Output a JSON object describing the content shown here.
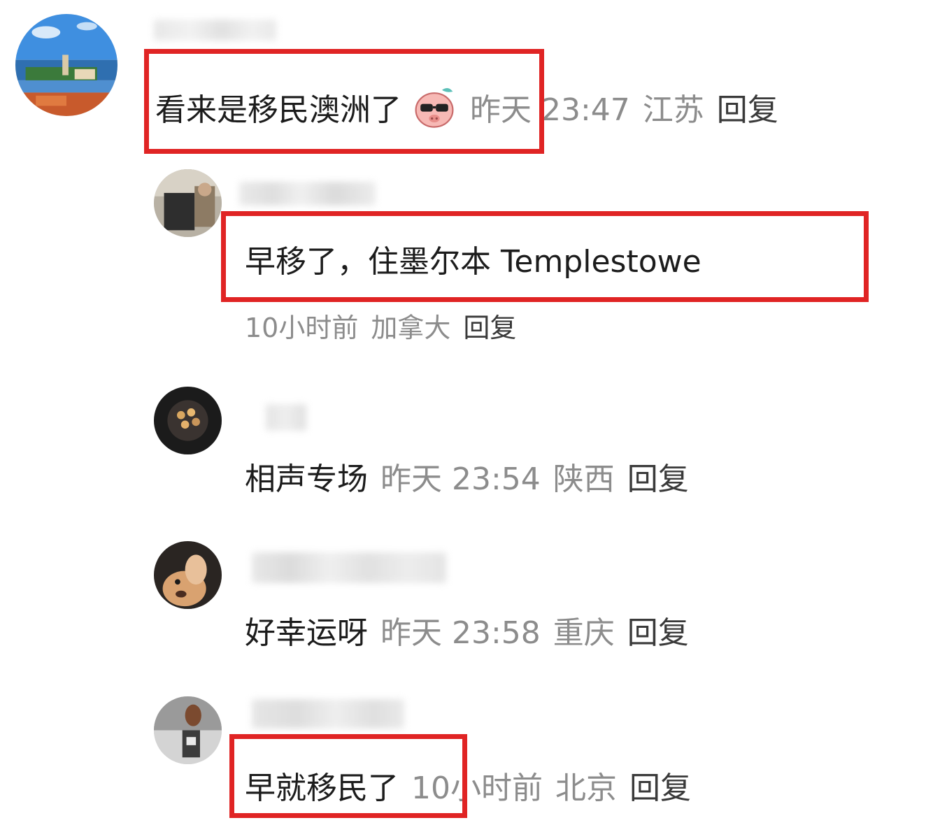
{
  "comments": [
    {
      "text": "看来是移民澳洲了",
      "emoji": "cool-pig-emoji",
      "time": "昨天 23:47",
      "location": "江苏",
      "reply_label": "回复"
    },
    {
      "text": "早移了，住墨尔本 Templestowe",
      "time": "10小时前",
      "location": "加拿大",
      "reply_label": "回复"
    },
    {
      "text": "相声专场",
      "time": "昨天 23:54",
      "location": "陕西",
      "reply_label": "回复"
    },
    {
      "text": "好幸运呀",
      "time": "昨天 23:58",
      "location": "重庆",
      "reply_label": "回复"
    },
    {
      "text": "早就移民了",
      "time": "10小时前",
      "location": "北京",
      "reply_label": "回复"
    }
  ],
  "highlight_color": "#e02424"
}
